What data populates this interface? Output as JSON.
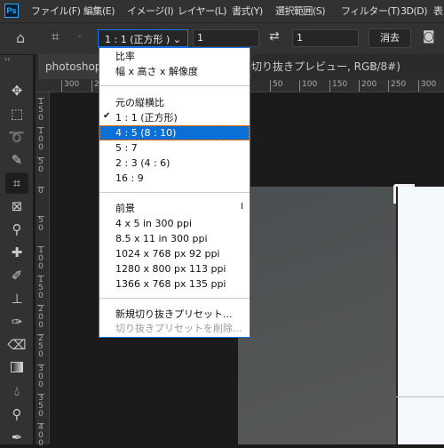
{
  "app": {
    "logo": "Ps"
  },
  "menubar": [
    "ファイル(F)",
    "編集(E)",
    "イメージ(I)",
    "レイヤー(L)",
    "書式(Y)",
    "選択範囲(S)",
    "フィルター(T)",
    "3D(D)",
    "表"
  ],
  "options": {
    "ratio_select": "1 : 1 (正方形 )",
    "width_value": "1",
    "height_value": "1",
    "clear_label": "消去"
  },
  "tabs": [
    {
      "label": "photoshop-"
    },
    {
      "label": "切り抜きプレビュー, RGB/8#)",
      "close": "×"
    }
  ],
  "rulers": {
    "horizontal": [
      "300",
      "250",
      "50",
      "100",
      "150",
      "200",
      "250",
      "300"
    ],
    "vertical": [
      "150",
      "100",
      "50",
      "0",
      "50",
      "100",
      "150",
      "200",
      "250",
      "300",
      "350",
      "400"
    ]
  },
  "dropdown": {
    "group1": [
      "比率",
      "幅 x 高さ x 解像度"
    ],
    "group2": [
      "元の縦横比",
      "1 : 1 (正方形)",
      "4 : 5 (8 : 10)",
      "5 : 7",
      "2 : 3 (4 : 6)",
      "16 : 9"
    ],
    "checked": "1 : 1 (正方形)",
    "highlighted": "4 : 5 (8 : 10)",
    "group3": [
      "前景",
      "4 x 5 in 300 ppi",
      "8.5 x 11 in 300 ppi",
      "1024 x 768 px 92 ppi",
      "1280 x 800 px 113 ppi",
      "1366 x 768 px 135 ppi"
    ],
    "group4": [
      "新規切り抜きプリセット...",
      "切り抜きプリセットを削除..."
    ],
    "check_mark": "✔",
    "cursor": "I"
  },
  "colors": {
    "accent": "#1473e6",
    "highlight": "#0a6fd6"
  }
}
